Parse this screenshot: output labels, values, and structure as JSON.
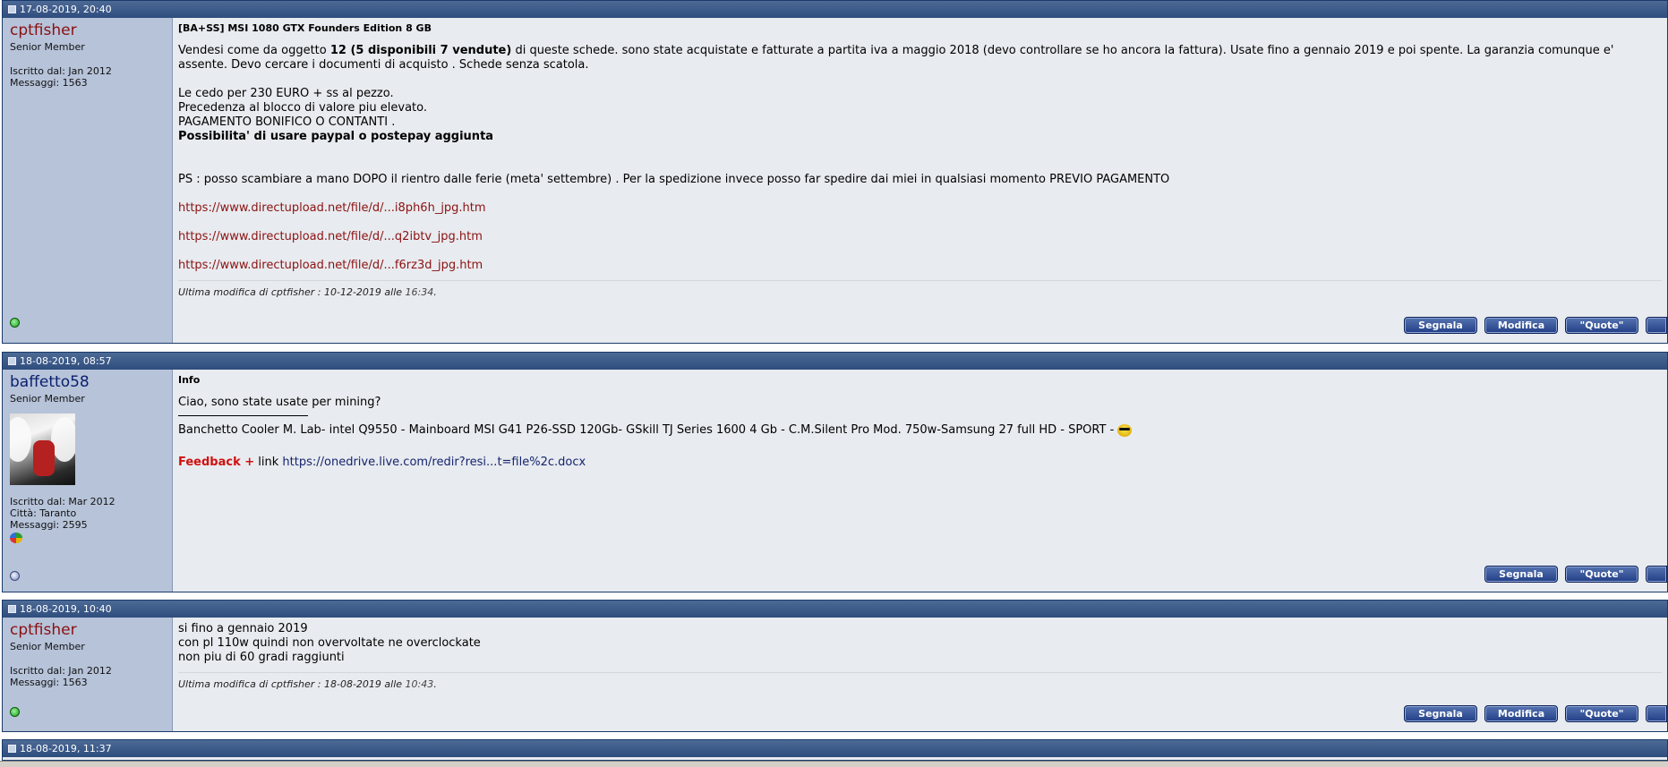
{
  "posts": [
    {
      "date": "17-08-2019, 20:40",
      "user": {
        "name": "cptfisher",
        "rank": "Senior Member",
        "joined": "Iscritto dal: Jan 2012",
        "messages": "Messaggi: 1563",
        "online": true
      },
      "title": "[BA+SS] MSI 1080 GTX Founders Edition 8 GB",
      "body": {
        "p1_pre": "Vendesi come da oggetto ",
        "p1_bold": "12 (5 disponibili 7 vendute)",
        "p1_post": " di queste schede. sono state acquistate e fatturate a partita iva a maggio 2018 (devo controllare se ho ancora la fattura). Usate fino a gennaio 2019 e poi spente. La garanzia comunque e' assente. Devo cercare i documenti di acquisto . Schede senza scatola.",
        "l1": "Le cedo per 230 EURO + ss al pezzo.",
        "l2": "Precedenza al blocco di valore piu elevato.",
        "l3": "PAGAMENTO BONIFICO O CONTANTI .",
        "l4": "Possibilita' di usare paypal o postepay aggiunta",
        "ps": "PS : posso scambiare a mano DOPO il rientro dalle ferie (meta' settembre) . Per la spedizione invece posso far spedire dai miei in qualsiasi momento PREVIO PAGAMENTO",
        "links": [
          "https://www.directupload.net/file/d/...i8ph6h_jpg.htm",
          "https://www.directupload.net/file/d/...q2ibtv_jpg.htm",
          "https://www.directupload.net/file/d/...f6rz3d_jpg.htm"
        ]
      },
      "edit_pre": "Ultima modifica di cptfisher : 10-12-2019 alle ",
      "edit_time": "16:34",
      "edit_post": ".",
      "buttons": [
        "Segnala",
        "Modifica",
        "\"Quote\""
      ]
    },
    {
      "date": "18-08-2019, 08:57",
      "user": {
        "name": "baffetto58",
        "rank": "Senior Member",
        "joined": "Iscritto dal: Mar 2012",
        "city": "Città: Taranto",
        "messages": "Messaggi: 2595",
        "online": false
      },
      "title": "Info",
      "body": {
        "text": "Ciao, sono state usate per mining?",
        "signature": "Banchetto Cooler M. Lab- intel Q9550 - Mainboard MSI G41 P26-SSD 120Gb- GSkill TJ Series 1600 4 Gb - C.M.Silent Pro Mod. 750w-Samsung 27 full HD - SPORT -",
        "feedback_label": "Feedback +",
        "feedback_word": " link ",
        "feedback_link": "https://onedrive.live.com/redir?resi...t=file%2c.docx"
      },
      "buttons": [
        "Segnala",
        "\"Quote\""
      ]
    },
    {
      "date": "18-08-2019, 10:40",
      "user": {
        "name": "cptfisher",
        "rank": "Senior Member",
        "joined": "Iscritto dal: Jan 2012",
        "messages": "Messaggi: 1563",
        "online": true
      },
      "body": {
        "l1": "si fino a gennaio 2019",
        "l2": "con pl 110w quindi non overvoltate ne overclockate",
        "l3": "non piu di 60 gradi raggiunti"
      },
      "edit_pre": "Ultima modifica di cptfisher : 18-08-2019 alle ",
      "edit_time": "10:43",
      "edit_post": ".",
      "buttons": [
        "Segnala",
        "Modifica",
        "\"Quote\""
      ]
    },
    {
      "date": "18-08-2019, 11:37"
    }
  ]
}
